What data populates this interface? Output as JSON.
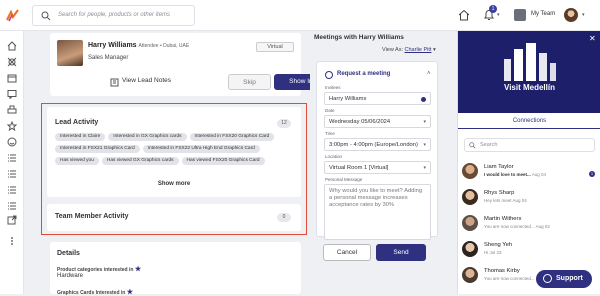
{
  "header": {
    "search_placeholder": "Search for people, products or other items",
    "notification_count": "1",
    "team_label": "My Team"
  },
  "profile": {
    "name": "Harry Williams",
    "subtitle": "Attendee • Dubai, UAE",
    "job_title": "Sales Manager",
    "attendance": "Virtual",
    "view_notes": "View Lead Notes",
    "skip": "Skip",
    "show_interest": "Show Interest"
  },
  "lead_activity": {
    "title": "Lead Activity",
    "count": "12",
    "chips": [
      "Interested in Claire",
      "Interested in GX Graphics cards",
      "Interested in FSX20 Graphics Card",
      "Interested in FSX21 Graphics Card",
      "Interested in FSX22 Ultra High End Graphics Card",
      "Has viewed you",
      "Has viewed GX Graphics cards",
      "Has viewed FSX20 Graphics Card"
    ],
    "show_more": "Show more"
  },
  "team_activity": {
    "title": "Team Member Activity",
    "count": "0"
  },
  "details": {
    "title": "Details",
    "product_label": "Product categories interested in",
    "product_value": "Hardware",
    "second_label": "Graphics Cards Interested in"
  },
  "meetings": {
    "title": "Meetings with Harry Williams",
    "view_as_label": "View As:",
    "view_as_name": "Charlie Pitt",
    "request_title": "Request a meeting",
    "invitees_label": "Invitees",
    "invitee": "Harry Williams",
    "date_label": "Date",
    "date": "Wednesday 05/06/2024",
    "time_label": "Time",
    "time": "3:00pm - 4:00pm (Europe/London)",
    "location_label": "Location",
    "location": "Virtual Room 1 [Virtual]",
    "message_label": "Personal Message",
    "message_placeholder": "Why would you like to meet? Adding a personal message increases acceptance rates by 30%",
    "cancel": "Cancel",
    "send": "Send"
  },
  "right_panel": {
    "banner_text": "Visit Medellín",
    "tab": "Connections",
    "search_placeholder": "Search",
    "connections": [
      {
        "name": "Liam Taylor",
        "msg_bold": "I would love to meet...",
        "date": "Aug 04",
        "badge": "1"
      },
      {
        "name": "Rhys Sharp",
        "msg_bold": "",
        "msg": "Hey lets meet",
        "date": "Aug 04",
        "badge": ""
      },
      {
        "name": "Martin Withers",
        "msg_bold": "",
        "msg": "You are now connected...",
        "date": "Aug 02",
        "badge": ""
      },
      {
        "name": "Sheng Yeh",
        "msg_bold": "",
        "msg": "Hi",
        "date": "Jul 23",
        "badge": ""
      },
      {
        "name": "Thomas Kirby",
        "msg_bold": "",
        "msg": "You are now connected...",
        "date": "",
        "badge": ""
      }
    ],
    "support": "Support"
  },
  "colors": {
    "primary": "#2f3180",
    "highlight": "#e04a3a",
    "banner": "#1d1f6b"
  }
}
